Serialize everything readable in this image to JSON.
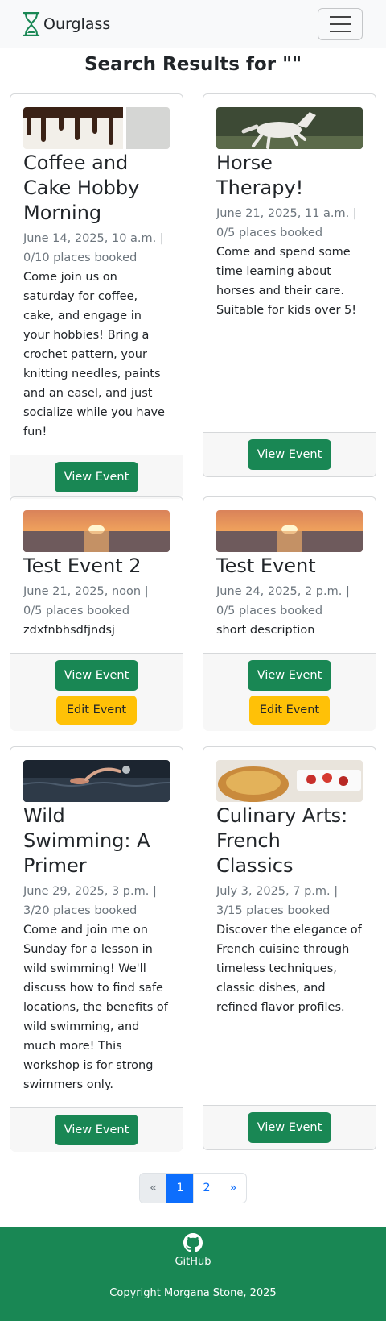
{
  "nav": {
    "brand": "Ourglass",
    "icon": "hourglass-icon",
    "menu_icon": "hamburger-icon"
  },
  "page_title": "Search Results for \"\"",
  "events": [
    {
      "title": "Coffee and Cake Hobby Morning",
      "meta": "June 14, 2025, 10 a.m. | 0/10 places booked",
      "description": "Come join us on saturday for coffee, cake, and engage in your hobbies! Bring a crochet pattern, your knitting needles, paints and an easel, and just socialize while you have fun!",
      "view": "View Event"
    },
    {
      "title": "Horse Therapy!",
      "meta": "June 21, 2025, 11 a.m. | 0/5 places booked",
      "description": "Come and spend some time learning about horses and their care. Suitable for kids over 5!",
      "view": "View Event"
    },
    {
      "title": "Test Event 2",
      "meta": "June 21, 2025, noon | 0/5 places booked",
      "description": "zdxfnbhsdfjndsj",
      "view": "View Event",
      "edit": "Edit Event"
    },
    {
      "title": "Test Event",
      "meta": "June 24, 2025, 2 p.m. | 0/5 places booked",
      "description": "short description",
      "view": "View Event",
      "edit": "Edit Event"
    },
    {
      "title": "Wild Swimming: A Primer",
      "meta": "June 29, 2025, 3 p.m. | 3/20 places booked",
      "description": "Come and join me on Sunday for a lesson in wild swimming! We'll discuss how to find safe locations, the benefits of wild swimming, and much more! This workshop is for strong swimmers only.",
      "view": "View Event"
    },
    {
      "title": "Culinary Arts: French Classics",
      "meta": "July 3, 2025, 7 p.m. | 3/15 places booked",
      "description": "Discover the elegance of French cuisine through timeless techniques, classic dishes, and refined flavor profiles.",
      "view": "View Event"
    }
  ],
  "pagination": {
    "prev": "«",
    "pages": [
      "1",
      "2"
    ],
    "current": "1",
    "next": "»"
  },
  "footer": {
    "github": "GitHub",
    "copyright": "Copyright Morgana Stone, 2025"
  },
  "colors": {
    "success": "#198754",
    "warning": "#ffc107",
    "primary": "#0d6efd"
  }
}
